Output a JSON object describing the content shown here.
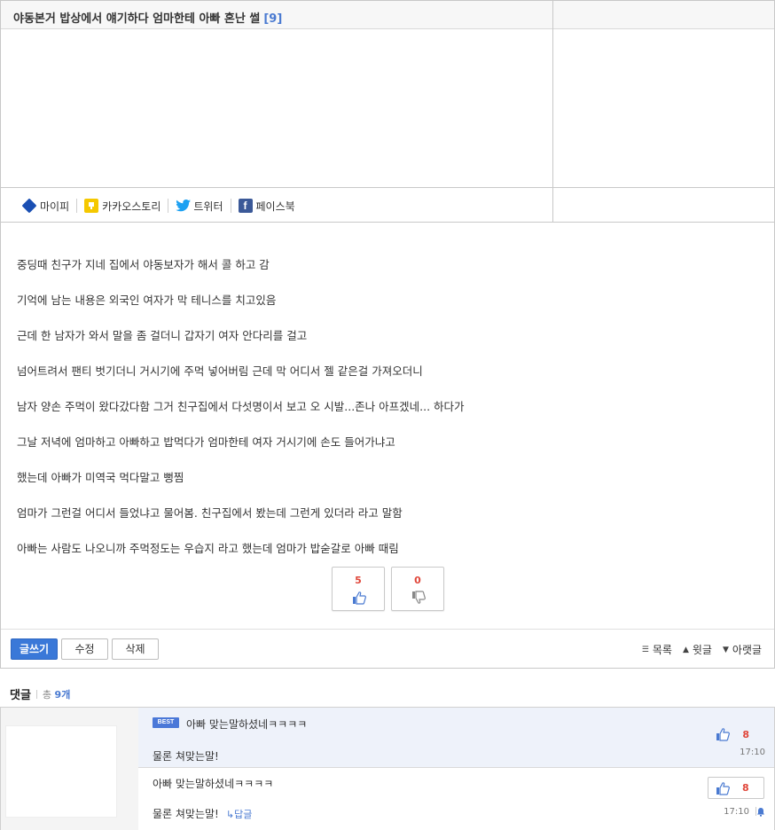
{
  "post": {
    "title": "야동본거 밥상에서 얘기하다 엄마한테 아빠 혼난 썰",
    "comment_count_label": "[9]",
    "body": [
      "중딩때 친구가 지네 집에서 야동보자가 해서 콜 하고 감",
      "기억에 남는 내용은 외국인 여자가 막 테니스를 치고있음",
      "근데 한 남자가 와서 말을 좀 걸더니 갑자기 여자 안다리를 걸고",
      "넘어트려서 팬티 벗기더니 거시기에 주먹 넣어버림 근데 막 어디서 젤 같은걸 가져오더니",
      "남자 양손 주먹이 왔다갔다함 그거 친구집에서 다섯명이서 보고 오 시발...존나 아프겠네... 하다가",
      "그날 저녁에 엄마하고 아빠하고 밥먹다가 엄마한테 여자 거시기에 손도 들어가냐고",
      "했는데 아빠가 미역국 먹다말고 뻥찜",
      "엄마가 그런걸 어디서 들었냐고 물어봄. 친구집에서 봤는데 그런게 있더라 라고 말함",
      "아빠는 사람도 나오니까 주먹정도는 우습지 라고 했는데 엄마가 밥숟갈로 아빠 때림"
    ],
    "upvotes": "5",
    "downvotes": "0"
  },
  "share": {
    "mypi": "마이피",
    "kakaostory": "카카오스토리",
    "twitter": "트위터",
    "facebook": "페이스북"
  },
  "actions": {
    "write": "글쓰기",
    "edit": "수정",
    "delete": "삭제",
    "list": "목록",
    "prev": "윗글",
    "next": "아랫글"
  },
  "comments": {
    "title": "댓글",
    "total_prefix": "총",
    "total_count": "9개",
    "items": [
      {
        "badge": "BEST",
        "line1": "아빠 맞는말하셨네ㅋㅋㅋㅋ",
        "line2": "물론 쳐맞는말!",
        "likes": "8",
        "time": "17:10"
      },
      {
        "line1": "아빠 맞는말하셨네ㅋㅋㅋㅋ",
        "line2": "물론 쳐맞는말!",
        "reply_label": "↳답글",
        "likes": "8",
        "time": "17:10"
      }
    ]
  },
  "colors": {
    "accent": "#3a78d8",
    "vote_count": "#e0463a",
    "best_bg": "#eef2fa"
  }
}
